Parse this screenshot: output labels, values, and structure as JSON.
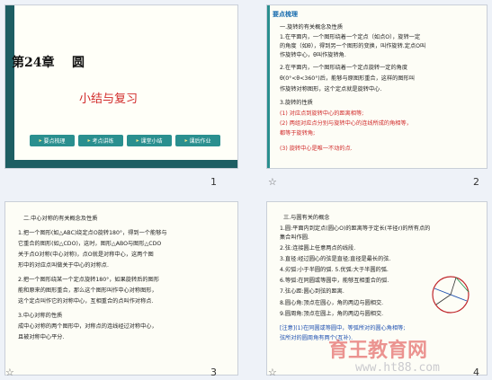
{
  "slide1": {
    "chapter": "第24章    圆",
    "title": "小结与复习",
    "nav": [
      "要点梳理",
      "考点讲练",
      "课堂小结",
      "课后作业"
    ],
    "page": "1"
  },
  "slide2": {
    "header": "要点梳理",
    "lines": [
      "一.旋转的有关概念及性质",
      "1.在平面内，一个图形绕着一个定点（如点O），旋转一定",
      "的角度（如θ），得到另一个图形的变换，叫作旋转.定点O叫",
      "作旋转中心，θ叫作旋转角.",
      "2.在平面内，一个图形绕着一个定点旋转一定的角度",
      "θ(0°<θ<360°)后，能够与原图形重合，这样的图形叫",
      "作旋转对称图形，这个定点就是旋转中心.",
      "3.旋转的性质",
      "(1) 对应点到旋转中心的距离相等;",
      "(2) 两组对应点分别与旋转中心的连线所成的角相等，",
      "    都等于旋转角;",
      "(3) 旋转中心是唯一不动的点."
    ],
    "page": "2",
    "star": "☆"
  },
  "slide3": {
    "lines": [
      "二.中心对称的有关概念及性质",
      "1.把一个图形(如△ABC)绕定点O旋转180°，得到一个能够与",
      "它重合的图形(如△CDO)，这时，图形△ABO与图形△CDO",
      "关于点O对称(中心对称)，点O就是对称中心，这两个图",
      "形中的对应点叫做关于中心的对称点.",
      "2.把一个图形绕某一个定点旋转180°，如果旋转后的图形",
      "能和原来的图形重合，那么这个图形叫作中心对称图形，",
      "这个定点叫作它的对称中心，互相重合的点叫作对称点.",
      "3.中心对称的性质",
      "成中心对称的两个图形中，对称点的连线经过对称中心，",
      "且被对称中心平分."
    ],
    "page": "3",
    "star": "☆"
  },
  "slide4": {
    "lines": [
      "三.与圆有关的概念",
      "1.圆:平面内到定点(圆心O)的距离等于定长(半径r)的所有点的",
      "  集合叫作圆.",
      "2.弦:连接圆上任意两点的线段.",
      "3.直径:经过圆心的弦是直径;直径是最长的弦.",
      "4.劣弧:小于半圆的弧.  5.优弧:大于半圆的弧.",
      "6.等弧:在同圆或等圆中，能够互相重合的弧.",
      "7.弦心距:圆心到弦的距离.",
      "8.圆心角:顶点在圆心，角的两边与圆相交.",
      "9.圆周角:顶点在圆上，角的两边与圆相交."
    ],
    "note": "[注意](1)在同圆或等圆中，等弧所对的圆心角相等;",
    "note2": "弦所对的圆周角有两个(互补).",
    "page": "4",
    "star": "☆"
  },
  "watermark": {
    "brand": "育王教育网",
    "site": "www.ht88.com"
  }
}
